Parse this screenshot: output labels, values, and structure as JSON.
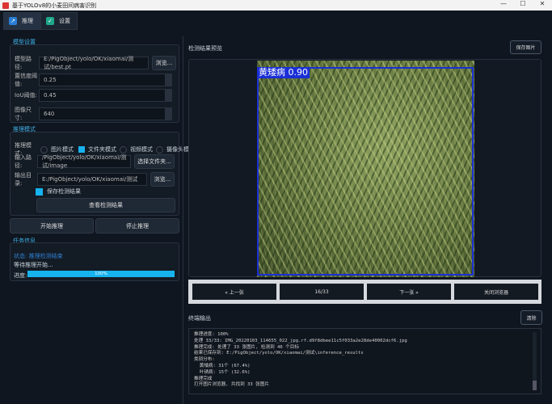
{
  "window": {
    "title": "基于YOLOv8的小麦田间病害识别",
    "min": "—",
    "max": "☐",
    "close": "✕"
  },
  "tabs": [
    {
      "label": "推理",
      "icon": "chart-icon"
    },
    {
      "label": "设置",
      "icon": "check-icon"
    }
  ],
  "model": {
    "title": "模型设置",
    "path_label": "模型路径:",
    "path": "E:/PigObject/yolo/OK/xiaomai/测试/best.pt",
    "browse": "浏览...",
    "conf_label": "置信度阈值:",
    "conf": "0.25",
    "iou_label": "IoU阈值:",
    "iou": "0.45",
    "size_label": "图像尺寸:",
    "size": "640"
  },
  "mode": {
    "title": "推理模式",
    "label": "推理模式:",
    "options": [
      "图片模式",
      "文件夹模式",
      "视频模式",
      "摄像头模式"
    ],
    "selected": "文件夹模式",
    "input_label": "输入路径:",
    "input": "/PigObject/yolo/OK/xiaomai/测试/image",
    "choose_folder": "选择文件夹...",
    "output_label": "输出目录:",
    "output": "E:/PigObject/yolo/OK/xiaomai/测试",
    "browse": "浏览...",
    "save_label": "保存检测结果",
    "save_checked": true,
    "view_results": "查看检测结果"
  },
  "actions": {
    "start": "开始推理",
    "stop": "停止推理"
  },
  "task": {
    "title": "任务信息",
    "status": "状态: 推理检测结束",
    "waiting": "等待推理开始...",
    "progress_label": "进度:",
    "progress": 100,
    "progress_text": "100%"
  },
  "preview": {
    "title": "检测结果预览",
    "save": "保存图片",
    "detection_label": "黄矮病 0.90",
    "box_color": "#1a2fd6"
  },
  "nav": {
    "prev": "« 上一张",
    "counter": "16/33",
    "next": "下一张 »",
    "close": "关闭浏览器"
  },
  "terminal": {
    "title": "终端输出",
    "clear": "清除",
    "lines": [
      "推理进度: 100%",
      "处理 33/33: IMG_20220103_114655_022_jpg.rf.d9f8dbee11c5f033a2e28de40002dcf6.jpg",
      "推理完成: 处理了 33 张图片, 检测到 46 个目标",
      "结果已保存到: E:/PigObject/yolo/OK/xiaomai/测试\\inference_results",
      "类别分布:",
      "  黄矮病: 31个 (67.4%)",
      "  叶锈病: 15个 (32.6%)",
      "推理完成",
      "打开图片浏览器, 共找到 33 张图片"
    ]
  },
  "colors": {
    "accent": "#17b3ef",
    "bg": "#0f1620"
  }
}
